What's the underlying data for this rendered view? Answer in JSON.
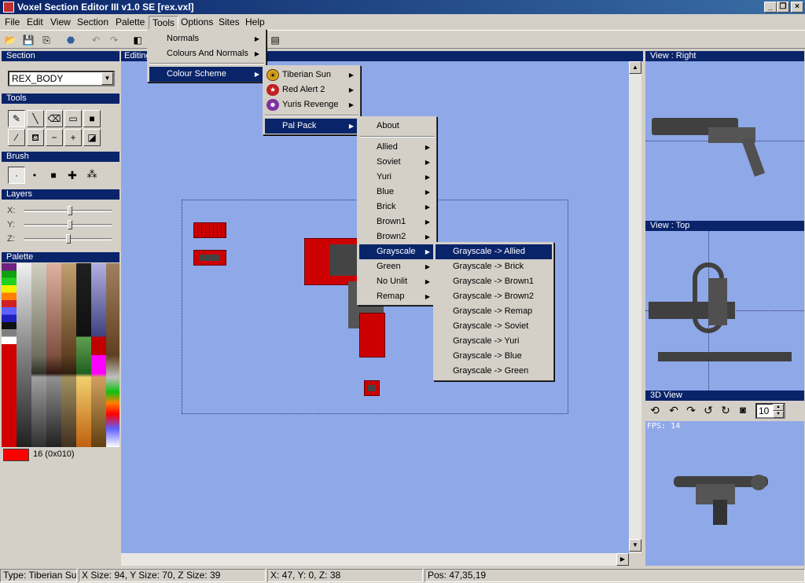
{
  "window": {
    "title": "Voxel Section Editor III v1.0 SE [rex.vxl]"
  },
  "menubar": [
    "File",
    "Edit",
    "View",
    "Section",
    "Palette",
    "Tools",
    "Options",
    "Sites",
    "Help"
  ],
  "left": {
    "section_header": "Section",
    "section_value": "REX_BODY",
    "tools_header": "Tools",
    "brush_header": "Brush",
    "layers_header": "Layers",
    "layer_labels": [
      "X:",
      "Y:",
      "Z:"
    ],
    "palette_header": "Palette",
    "palette_selected": "16 (0x010)",
    "selected_color": "#ff0000"
  },
  "editor": {
    "header": "Editing"
  },
  "views": {
    "right_header": "View : Right",
    "top_header": "View : Top",
    "view3d_header": "3D View",
    "fps": "FPS: 14",
    "spin_value": "10"
  },
  "menus": {
    "tools": [
      "Normals",
      "Colours And Normals",
      "Colour Scheme"
    ],
    "colour_scheme": [
      "Tiberian Sun",
      "Red Alert 2",
      "Yuris Revenge",
      "Pal Pack"
    ],
    "pal_pack": [
      "About",
      "Allied",
      "Soviet",
      "Yuri",
      "Blue",
      "Brick",
      "Brown1",
      "Brown2",
      "Grayscale",
      "Green",
      "No Unlit",
      "Remap"
    ],
    "grayscale": [
      "Grayscale -> Allied",
      "Grayscale -> Brick",
      "Grayscale -> Brown1",
      "Grayscale -> Brown2",
      "Grayscale -> Remap",
      "Grayscale -> Soviet",
      "Grayscale -> Yuri",
      "Grayscale -> Blue",
      "Grayscale -> Green"
    ]
  },
  "status": {
    "type": "Type: Tiberian Sun",
    "size": "X Size: 94, Y Size: 70, Z Size: 39",
    "coords": "X: 47, Y: 0, Z: 38",
    "pos": "Pos: 47,35,19"
  },
  "colors": {
    "accent": "#0a246a",
    "view_bg": "#8fa8e8",
    "voxel_red": "#cc0000"
  }
}
